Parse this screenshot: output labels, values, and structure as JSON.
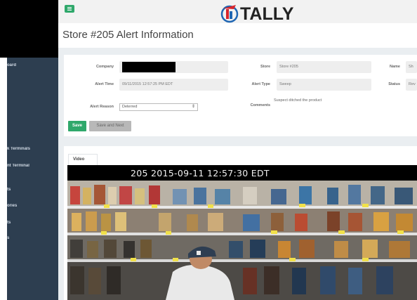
{
  "brand": {
    "logo_text": "TALLY",
    "colors": {
      "primary_green": "#2fa86b",
      "sidebar": "#2d3e50",
      "logo_red": "#d7262d",
      "logo_blue": "#1f66b3"
    }
  },
  "header": {
    "menu_icon": "hamburger-icon"
  },
  "sidebar": {
    "items": [
      {
        "label": "oard"
      },
      {
        "label": "k Terminals"
      },
      {
        "label": "nt Terminal"
      },
      {
        "label": "ts"
      },
      {
        "label": "ories"
      },
      {
        "label": "ts"
      },
      {
        "label": "s"
      }
    ]
  },
  "page": {
    "title": "Store #205 Alert Information"
  },
  "form": {
    "company": {
      "label": "Company",
      "value": ""
    },
    "store": {
      "label": "Store",
      "value": "Store #205"
    },
    "name": {
      "label": "Name",
      "value": "Sh"
    },
    "alert_time": {
      "label": "Alert Time",
      "value": "09/11/2015 12:57:25 PM EDT"
    },
    "alert_type": {
      "label": "Alert Type",
      "value": "Sweep"
    },
    "status": {
      "label": "Status",
      "value": "Rev"
    },
    "alert_reason": {
      "label": "Alert Reason",
      "selected": "Deterred"
    },
    "comments": {
      "label": "Comments",
      "value": "Suspect ditched the product"
    }
  },
  "actions": {
    "save_label": "Save",
    "save_next_label": "Save and Next"
  },
  "video": {
    "tab_label": "Video",
    "overlay_text": "205 2015-09-11 12:57:30 EDT"
  }
}
